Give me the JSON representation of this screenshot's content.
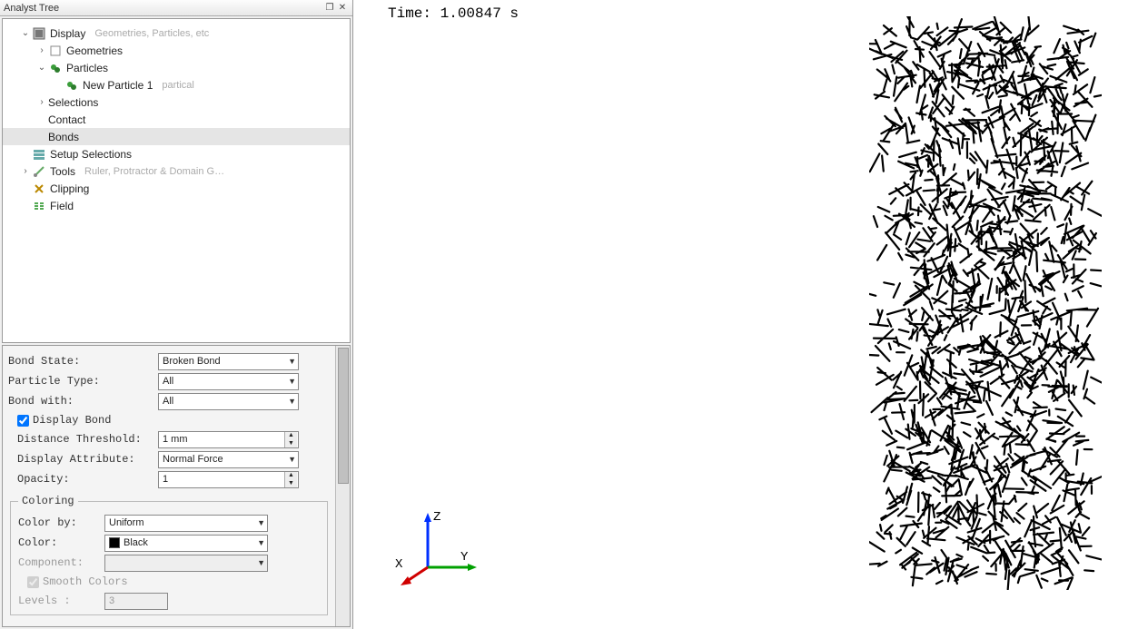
{
  "panel": {
    "title": "Analyst Tree"
  },
  "tree": {
    "display": {
      "label": "Display",
      "hint": "Geometries, Particles, etc"
    },
    "geom": {
      "label": "Geometries"
    },
    "particles": {
      "label": "Particles"
    },
    "np1": {
      "label": "New Particle 1",
      "hint": "partical"
    },
    "selections": {
      "label": "Selections"
    },
    "contact": {
      "label": "Contact"
    },
    "bonds": {
      "label": "Bonds"
    },
    "setup": {
      "label": "Setup Selections"
    },
    "tools": {
      "label": "Tools",
      "hint": "Ruler, Protractor & Domain G…"
    },
    "clipping": {
      "label": "Clipping"
    },
    "field": {
      "label": "Field"
    }
  },
  "props": {
    "bond_state_label": "Bond State:",
    "bond_state_value": "Broken Bond",
    "particle_type_label": "Particle Type:",
    "particle_type_value": "All",
    "bond_with_label": "Bond with:",
    "bond_with_value": "All",
    "display_bond_label": "Display Bond",
    "distance_label": "Distance Threshold:",
    "distance_value": "1 mm",
    "disp_attr_label": "Display Attribute:",
    "disp_attr_value": "Normal Force",
    "opacity_label": "Opacity:",
    "opacity_value": "1",
    "coloring_legend": "Coloring",
    "color_by_label": "Color by:",
    "color_by_value": "Uniform",
    "color_label": "Color:",
    "color_value": "Black",
    "component_label": "Component:",
    "component_value": "",
    "smooth_label": "Smooth Colors",
    "levels_label": "Levels :",
    "levels_value": "3"
  },
  "viewport": {
    "time": "Time: 1.00847 s",
    "axes": {
      "x": "X",
      "y": "Y",
      "z": "Z"
    }
  }
}
